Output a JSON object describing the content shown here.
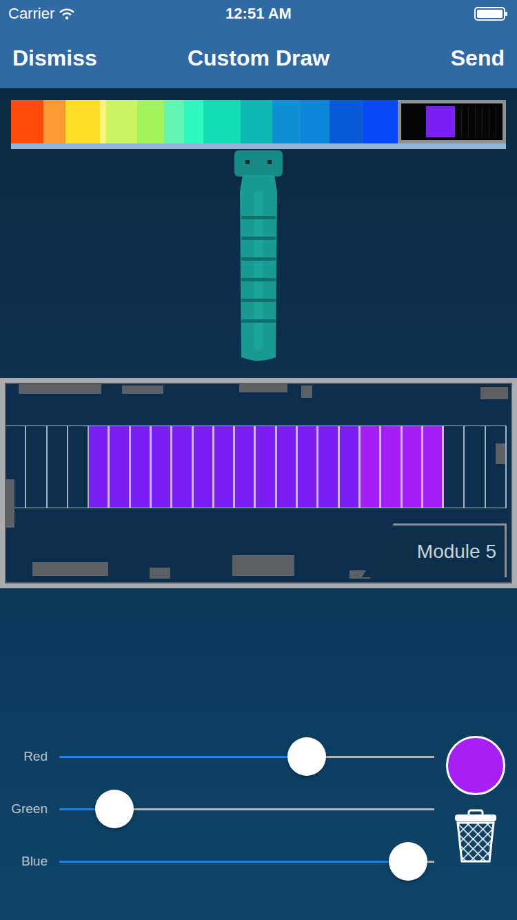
{
  "status_bar": {
    "carrier": "Carrier",
    "time": "12:51 AM"
  },
  "nav": {
    "left": "Dismiss",
    "title": "Custom Draw",
    "right": "Send"
  },
  "palette": [
    {
      "kind": "swatch",
      "color": "#ff4b0b"
    },
    {
      "kind": "swatch",
      "color": "#ff9933"
    },
    {
      "kind": "swatch",
      "color": "#ffdd2b"
    },
    {
      "kind": "swatch",
      "color": "#fff27a"
    },
    {
      "kind": "swatch",
      "color": "#cbf463"
    },
    {
      "kind": "swatch",
      "color": "#a3f25e"
    },
    {
      "kind": "swatch",
      "color": "#62f5b2"
    },
    {
      "kind": "swatch",
      "color": "#2ff7bf"
    },
    {
      "kind": "swatch",
      "color": "#14ddb4"
    },
    {
      "kind": "swatch",
      "color": "#0db8b2"
    },
    {
      "kind": "swatch",
      "color": "#0f8fd6"
    },
    {
      "kind": "swatch",
      "color": "#0b86d6"
    },
    {
      "kind": "swatch",
      "color": "#0a5ad8"
    },
    {
      "kind": "swatch",
      "color": "#0848f6"
    },
    {
      "kind": "thumbnail",
      "color": "#7b1ff5"
    }
  ],
  "module": {
    "label": "Module 5",
    "cells": [
      {
        "color": null
      },
      {
        "color": null
      },
      {
        "color": null
      },
      {
        "color": null
      },
      {
        "color": "#7b1ff5"
      },
      {
        "color": "#7b1ff5"
      },
      {
        "color": "#7b1ff5"
      },
      {
        "color": "#7b1ff5"
      },
      {
        "color": "#7b1ff5"
      },
      {
        "color": "#7b1ff5"
      },
      {
        "color": "#7b1ff5"
      },
      {
        "color": "#7b1ff5"
      },
      {
        "color": "#7b1ff5"
      },
      {
        "color": "#7b1ff5"
      },
      {
        "color": "#7b1ff5"
      },
      {
        "color": "#7b1ff5"
      },
      {
        "color": "#7b1ff5"
      },
      {
        "color": "#a21ff5"
      },
      {
        "color": "#a21ff5"
      },
      {
        "color": "#a21ff5"
      },
      {
        "color": "#a21ff5"
      },
      {
        "color": null
      },
      {
        "color": null
      },
      {
        "color": null
      }
    ]
  },
  "sliders": [
    {
      "label": "Red",
      "level": 0.66
    },
    {
      "label": "Green",
      "level": 0.147
    },
    {
      "label": "Blue",
      "level": 0.93
    }
  ],
  "preview": {
    "color": "#a720f3"
  }
}
